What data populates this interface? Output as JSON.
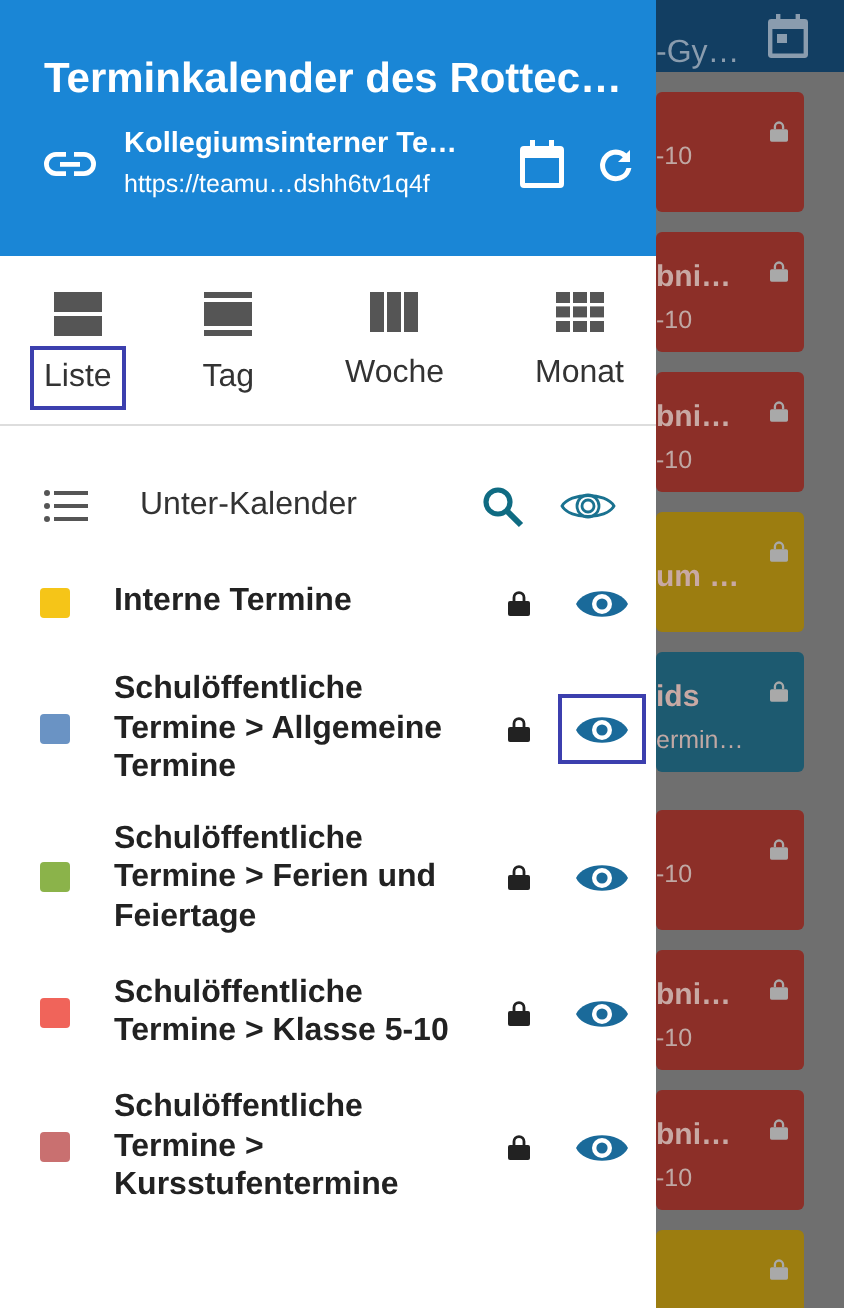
{
  "drawer": {
    "title": "Terminkalender des Rottec…",
    "calendar_name": "Kollegiumsinterner Te…",
    "url": "https://teamu…dshh6tv1q4f"
  },
  "views": [
    {
      "label": "Liste",
      "kind": "list",
      "selected": true
    },
    {
      "label": "Tag",
      "kind": "day",
      "selected": false
    },
    {
      "label": "Woche",
      "kind": "week",
      "selected": false
    },
    {
      "label": "Monat",
      "kind": "month",
      "selected": false
    }
  ],
  "subcalendar_header": {
    "label": "Unter-Kalender"
  },
  "subcalendars": [
    {
      "name": "Interne Termine",
      "color": "#f5c518",
      "locked": true,
      "visible": true,
      "highlighted": false
    },
    {
      "name": "Schulöffentliche Termine > Allgemeine Termine",
      "color": "#6a93c4",
      "locked": true,
      "visible": true,
      "highlighted": true
    },
    {
      "name": "Schulöffentliche Termine > Ferien und Feiertage",
      "color": "#8bb34a",
      "locked": true,
      "visible": true,
      "highlighted": false
    },
    {
      "name": "Schulöffentliche Termine > Klasse 5-10",
      "color": "#f0645a",
      "locked": true,
      "visible": true,
      "highlighted": false
    },
    {
      "name": "Schulöffentliche Termine > Kursstufentermine",
      "color": "#c97070",
      "locked": true,
      "visible": true,
      "highlighted": false
    }
  ],
  "background": {
    "header_text": "-Gy…",
    "cards": [
      {
        "color": "#8c2f28",
        "line_2": "-10"
      },
      {
        "color": "#8c2f28",
        "line_1": "bni…",
        "line_2": "-10"
      },
      {
        "color": "#8c2f28",
        "line_1": "bni…",
        "line_2": "-10"
      },
      {
        "color": "#9c7d10",
        "line_1": "um …"
      },
      {
        "color": "#1d5a70",
        "line_1": "ids",
        "line_2": "ermin…"
      },
      {
        "color": "#8c2f28",
        "line_2": "-10"
      },
      {
        "color": "#8c2f28",
        "line_1": "bni…",
        "line_2": "-10"
      },
      {
        "color": "#8c2f28",
        "line_1": "bni…",
        "line_2": "-10"
      },
      {
        "color": "#9c7d10"
      }
    ]
  }
}
